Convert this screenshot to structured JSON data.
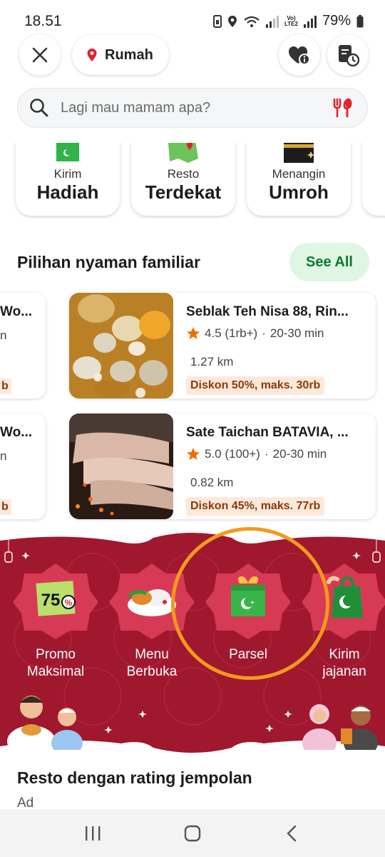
{
  "status_bar": {
    "time": "18.51",
    "network_label_top": "Vo)",
    "network_label_bottom": "LTE2",
    "battery": "79%"
  },
  "header": {
    "location_label": "Rumah",
    "close_icon": "close-icon",
    "favorites_icon": "heart-info-icon",
    "orders_icon": "order-history-icon"
  },
  "search": {
    "placeholder": "Lagi mau mamam apa?",
    "icon": "search-icon",
    "food_icon": "cutlery-icon"
  },
  "categories": [
    {
      "small": "Kirim",
      "big": "Hadiah"
    },
    {
      "small": "Resto",
      "big": "Terdekat"
    },
    {
      "small": "Menangin",
      "big": "Umroh"
    }
  ],
  "familiar": {
    "title": "Pilihan nyaman familiar",
    "see_all": "See All",
    "left_partial": [
      {
        "name": "Wo...",
        "meta": "n",
        "disc": "b"
      },
      {
        "name": "Wo...",
        "meta": "n",
        "disc": "b"
      }
    ],
    "restaurants": [
      {
        "name": "Seblak Teh Nisa 88, Rin...",
        "rating": "4.5 (1rb+)",
        "time": "20-30 min",
        "distance": "1.27 km",
        "discount": "Diskon 50%, maks. 30rb"
      },
      {
        "name": "Sate Taichan BATAVIA, ...",
        "rating": "5.0 (100+)",
        "time": "20-30 min",
        "distance": "0.82 km",
        "discount": "Diskon 45%, maks. 77rb"
      }
    ]
  },
  "ramadan": {
    "promos": [
      {
        "line1": "Promo",
        "line2": "Maksimal",
        "badge": "75"
      },
      {
        "line1": "Menu",
        "line2": "Berbuka"
      },
      {
        "line1": "Parsel",
        "line2": ""
      },
      {
        "line1": "Kirim",
        "line2": "jajanan"
      }
    ],
    "colors": {
      "background": "#a0182e",
      "accent": "#c42a44"
    }
  },
  "rating_section": {
    "title": "Resto dengan rating jempolan",
    "ad_label": "Ad"
  },
  "nav": {
    "recent_icon": "recent-apps-icon",
    "home_icon": "home-icon",
    "back_icon": "back-icon"
  }
}
